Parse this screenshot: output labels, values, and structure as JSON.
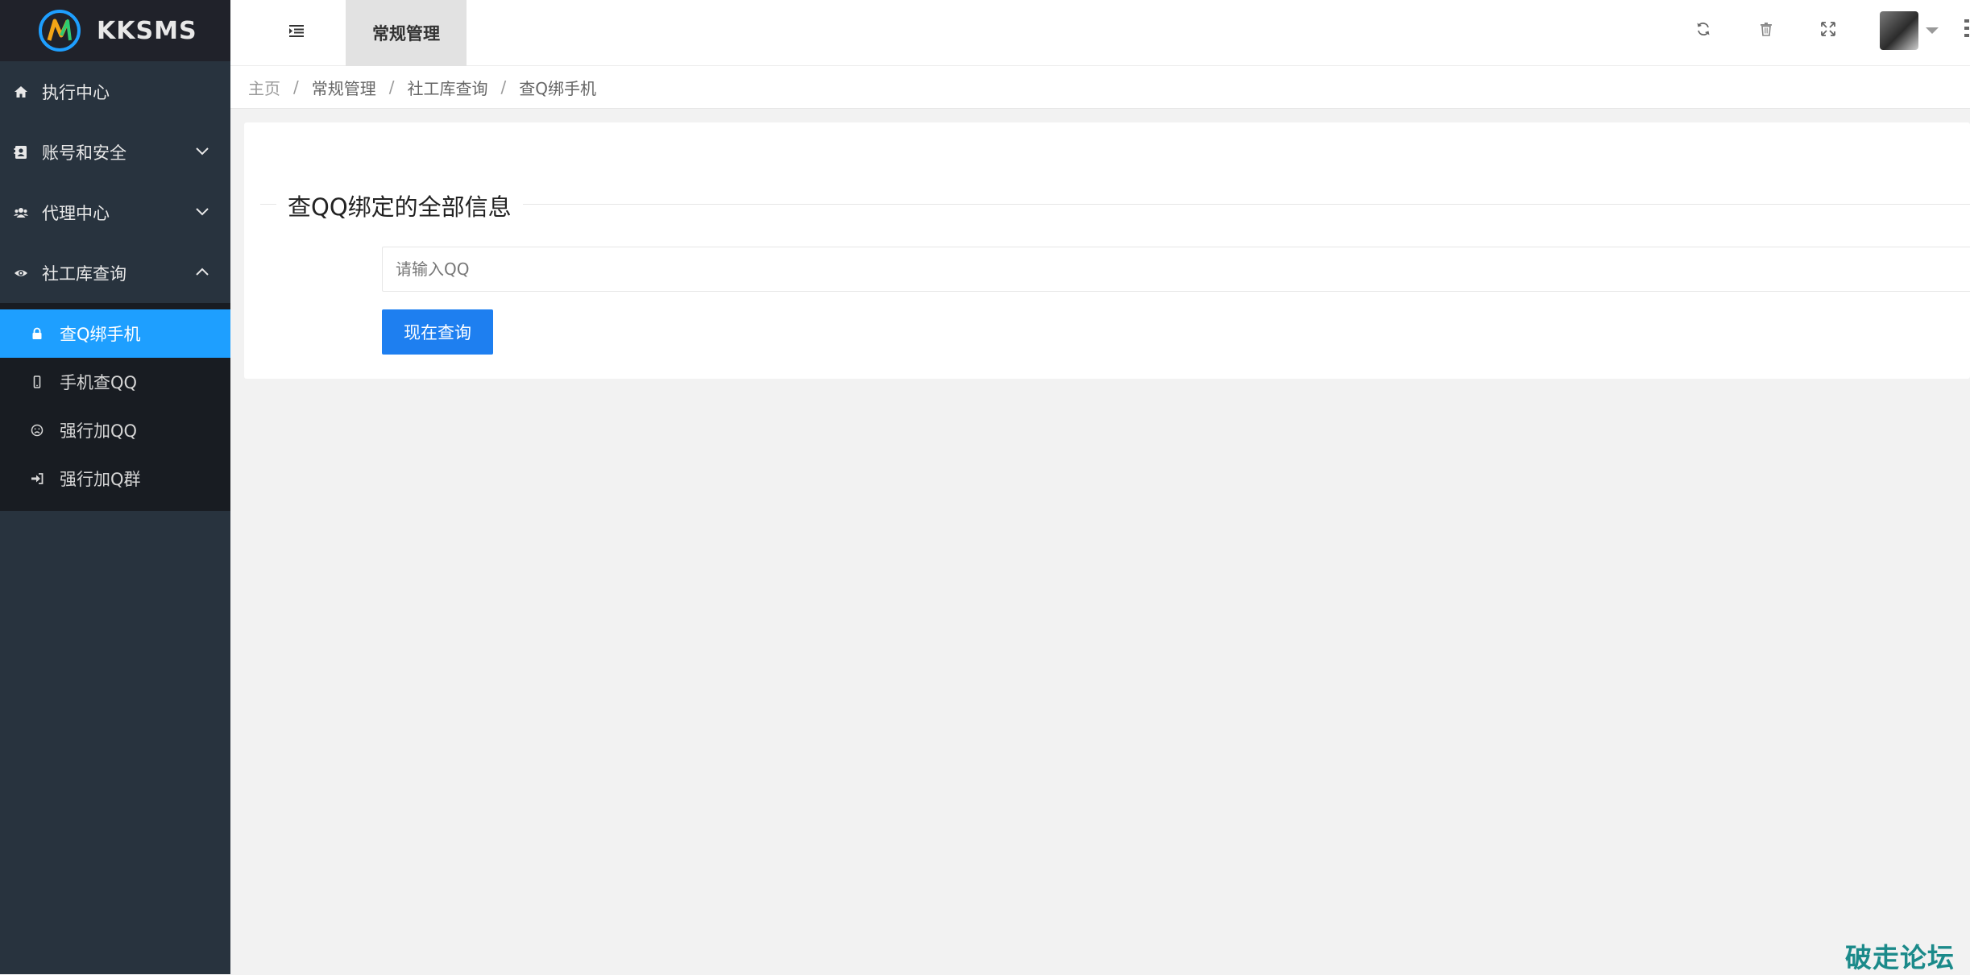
{
  "app": {
    "name": "KKSMS"
  },
  "sidebar": {
    "items": [
      {
        "label": "执行中心",
        "icon": "home-icon"
      },
      {
        "label": "账号和安全",
        "icon": "address-book-icon"
      },
      {
        "label": "代理中心",
        "icon": "users-icon"
      },
      {
        "label": "社工库查询",
        "icon": "eye-icon",
        "expanded": true
      }
    ],
    "submenu": [
      {
        "label": "查Q绑手机",
        "icon": "lock-icon",
        "active": true
      },
      {
        "label": "手机查QQ",
        "icon": "mobile-icon"
      },
      {
        "label": "强行加QQ",
        "icon": "frown-icon"
      },
      {
        "label": "强行加Q群",
        "icon": "sign-in-icon"
      }
    ]
  },
  "header": {
    "tab": "常规管理",
    "tools": [
      "refresh-icon",
      "trash-icon",
      "fullscreen-icon"
    ]
  },
  "breadcrumb": {
    "items": [
      "主页",
      "常规管理",
      "社工库查询",
      "查Q绑手机"
    ],
    "separator": "/"
  },
  "main": {
    "legend": "查QQ绑定的全部信息",
    "input_placeholder": "请输入QQ",
    "input_value": "",
    "button_label": "现在查询"
  },
  "watermark": "破走论坛",
  "colors": {
    "sidebar_bg": "#28333e",
    "logo_bg": "#20222a",
    "active_item": "#1e9fff",
    "primary_button": "#1e7ff0",
    "page_bg": "#f2f2f2"
  }
}
